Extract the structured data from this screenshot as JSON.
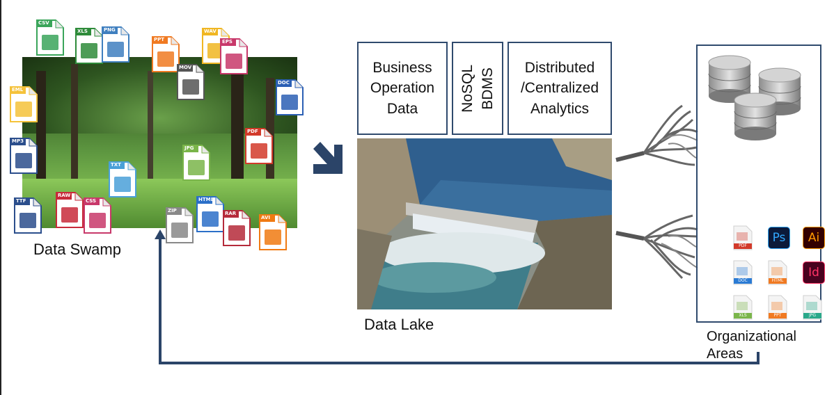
{
  "swamp": {
    "caption": "Data Swamp",
    "file_icons": [
      {
        "label": "CSV",
        "color": "#3aa55a"
      },
      {
        "label": "XLS",
        "color": "#2e8b3a"
      },
      {
        "label": "PNG",
        "color": "#3f7fbf"
      },
      {
        "label": "PPT",
        "color": "#f07a22"
      },
      {
        "label": "WAV",
        "color": "#f0b622"
      },
      {
        "label": "EPS",
        "color": "#c8386a"
      },
      {
        "label": "MOV",
        "color": "#555555"
      },
      {
        "label": "EML",
        "color": "#f5c23a"
      },
      {
        "label": "DOC",
        "color": "#2b5fb4"
      },
      {
        "label": "PDF",
        "color": "#d23a2a"
      },
      {
        "label": "MP3",
        "color": "#2b4e8c"
      },
      {
        "label": "JPG",
        "color": "#7ab54a"
      },
      {
        "label": "TXT",
        "color": "#4aa0d8"
      },
      {
        "label": "TTF",
        "color": "#2b4e8c"
      },
      {
        "label": "RAW",
        "color": "#c82a3a"
      },
      {
        "label": "CSS",
        "color": "#c8386a"
      },
      {
        "label": "ZIP",
        "color": "#888888"
      },
      {
        "label": "HTML",
        "color": "#2b6fc8"
      },
      {
        "label": "RAR",
        "color": "#b52a3a"
      },
      {
        "label": "AVI",
        "color": "#f07a12"
      }
    ]
  },
  "lake": {
    "caption": "Data Lake",
    "boxes": [
      {
        "text": "Business\nOperation\nData"
      },
      {
        "text": "NoSQL\nBDMS"
      },
      {
        "text": "Distributed\n/Centralized\nAnalytics"
      }
    ]
  },
  "org": {
    "caption": "Organizational\nAreas",
    "app_icons": [
      {
        "label": "PDF",
        "color": "#d23a2a"
      },
      {
        "label": "Ps",
        "color": "#31a8ff",
        "bg": "#0b1a3a"
      },
      {
        "label": "Ai",
        "color": "#ff9a00",
        "bg": "#330000"
      },
      {
        "label": "DOC",
        "color": "#2b7bd4"
      },
      {
        "label": "HTML",
        "color": "#f07a22"
      },
      {
        "label": "Id",
        "color": "#ff3366",
        "bg": "#49021f"
      },
      {
        "label": "XLS",
        "color": "#7ab54a"
      },
      {
        "label": "PPT",
        "color": "#f07a22"
      },
      {
        "label": "JPG",
        "color": "#2aa88a"
      }
    ]
  },
  "colors": {
    "arrow": "#2b4468",
    "box_border": "#2f4a6d"
  }
}
